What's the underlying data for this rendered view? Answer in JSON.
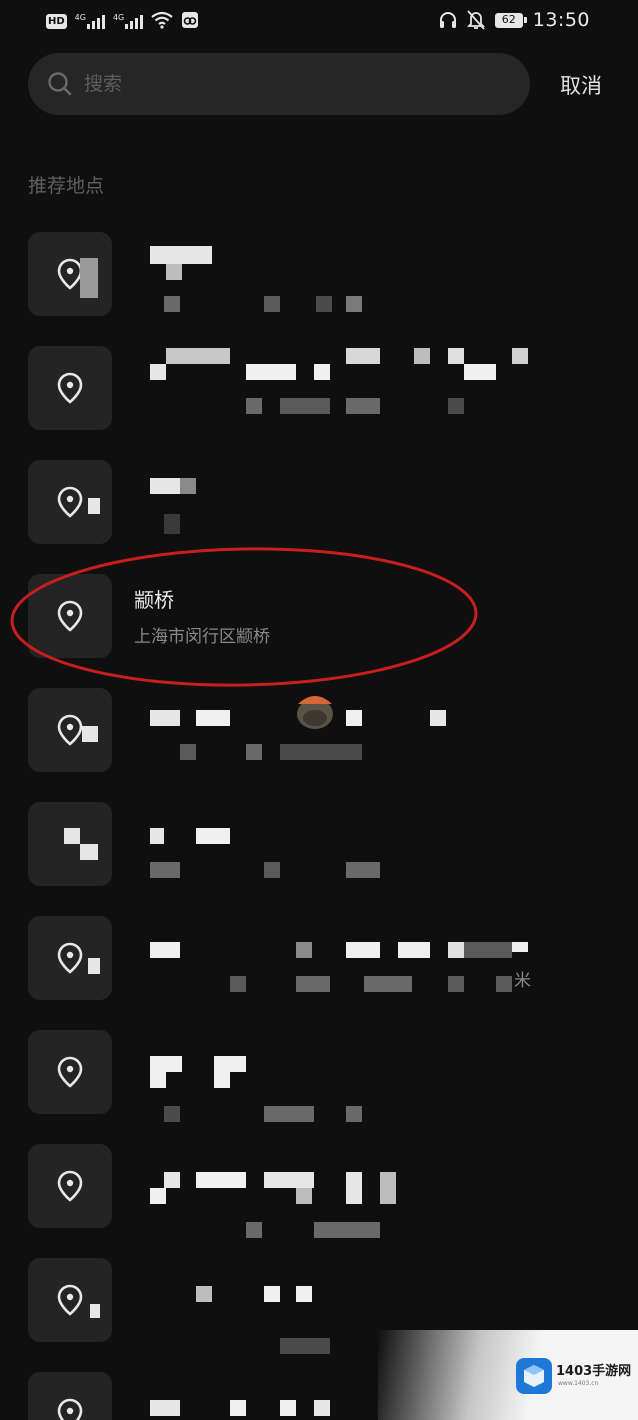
{
  "status_bar": {
    "hd_label": "HD",
    "sim1_network": "4G",
    "sim2_network": "4G",
    "battery_level": "62",
    "time": "13:50",
    "icons": [
      "hd-icon",
      "signal-icon",
      "wifi-icon",
      "link-icon",
      "headset-icon",
      "bell-off-icon",
      "battery-icon"
    ]
  },
  "search": {
    "placeholder": "搜索",
    "cancel_label": "取消"
  },
  "section": {
    "title": "推荐地点"
  },
  "places": [
    {
      "name": "",
      "address": "",
      "icon": "location-pin-icon",
      "obscured": true
    },
    {
      "name": "",
      "address": "",
      "icon": "location-pin-icon",
      "obscured": true
    },
    {
      "name": "",
      "address": "",
      "icon": "location-pin-icon",
      "obscured": true
    },
    {
      "name": "颛桥",
      "address": "上海市闵行区颛桥",
      "icon": "location-pin-icon",
      "obscured": false,
      "highlighted": true
    },
    {
      "name": "",
      "address": "",
      "icon": "location-pin-icon",
      "obscured": true
    },
    {
      "name": "",
      "address": "",
      "icon": "location-pin-icon",
      "obscured": true
    },
    {
      "name": "",
      "address": "米",
      "icon": "location-pin-icon",
      "obscured": true
    },
    {
      "name": "",
      "address": "",
      "icon": "location-pin-icon",
      "obscured": true
    },
    {
      "name": "",
      "address": "",
      "icon": "location-pin-icon",
      "obscured": true
    },
    {
      "name": "",
      "address": "",
      "icon": "location-pin-icon",
      "obscured": true
    },
    {
      "name": "",
      "address": "",
      "icon": "location-pin-icon",
      "obscured": true
    }
  ],
  "annotation": {
    "color": "#c81e1e"
  },
  "watermark": {
    "text": "1403手游网",
    "sub": "www.1403.cn"
  },
  "colors": {
    "background": "#0f0f0f",
    "search_bg": "#262626",
    "icon_box_bg": "#242424",
    "primary_text": "#ececec",
    "secondary_text": "#8a8a8a"
  }
}
